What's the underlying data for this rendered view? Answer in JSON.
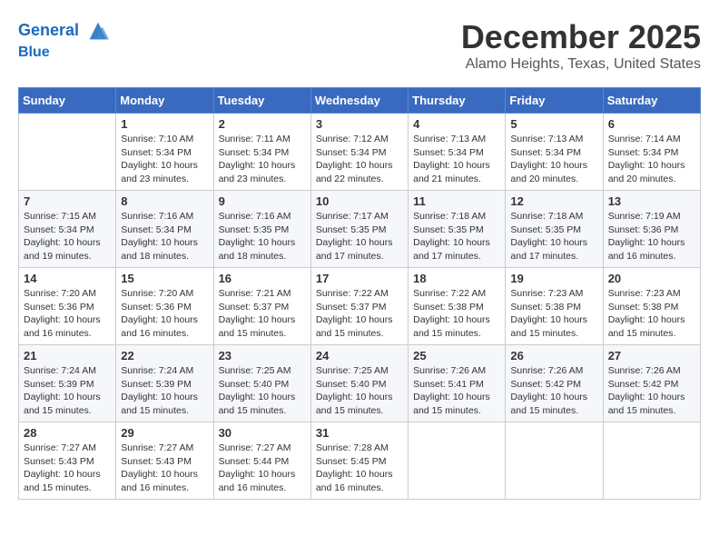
{
  "header": {
    "logo_line1": "General",
    "logo_line2": "Blue",
    "month": "December 2025",
    "location": "Alamo Heights, Texas, United States"
  },
  "days_of_week": [
    "Sunday",
    "Monday",
    "Tuesday",
    "Wednesday",
    "Thursday",
    "Friday",
    "Saturday"
  ],
  "weeks": [
    [
      {
        "day": "",
        "sunrise": "",
        "sunset": "",
        "daylight": ""
      },
      {
        "day": "1",
        "sunrise": "7:10 AM",
        "sunset": "5:34 PM",
        "daylight": "10 hours and 23 minutes."
      },
      {
        "day": "2",
        "sunrise": "7:11 AM",
        "sunset": "5:34 PM",
        "daylight": "10 hours and 23 minutes."
      },
      {
        "day": "3",
        "sunrise": "7:12 AM",
        "sunset": "5:34 PM",
        "daylight": "10 hours and 22 minutes."
      },
      {
        "day": "4",
        "sunrise": "7:13 AM",
        "sunset": "5:34 PM",
        "daylight": "10 hours and 21 minutes."
      },
      {
        "day": "5",
        "sunrise": "7:13 AM",
        "sunset": "5:34 PM",
        "daylight": "10 hours and 20 minutes."
      },
      {
        "day": "6",
        "sunrise": "7:14 AM",
        "sunset": "5:34 PM",
        "daylight": "10 hours and 20 minutes."
      }
    ],
    [
      {
        "day": "7",
        "sunrise": "7:15 AM",
        "sunset": "5:34 PM",
        "daylight": "10 hours and 19 minutes."
      },
      {
        "day": "8",
        "sunrise": "7:16 AM",
        "sunset": "5:34 PM",
        "daylight": "10 hours and 18 minutes."
      },
      {
        "day": "9",
        "sunrise": "7:16 AM",
        "sunset": "5:35 PM",
        "daylight": "10 hours and 18 minutes."
      },
      {
        "day": "10",
        "sunrise": "7:17 AM",
        "sunset": "5:35 PM",
        "daylight": "10 hours and 17 minutes."
      },
      {
        "day": "11",
        "sunrise": "7:18 AM",
        "sunset": "5:35 PM",
        "daylight": "10 hours and 17 minutes."
      },
      {
        "day": "12",
        "sunrise": "7:18 AM",
        "sunset": "5:35 PM",
        "daylight": "10 hours and 17 minutes."
      },
      {
        "day": "13",
        "sunrise": "7:19 AM",
        "sunset": "5:36 PM",
        "daylight": "10 hours and 16 minutes."
      }
    ],
    [
      {
        "day": "14",
        "sunrise": "7:20 AM",
        "sunset": "5:36 PM",
        "daylight": "10 hours and 16 minutes."
      },
      {
        "day": "15",
        "sunrise": "7:20 AM",
        "sunset": "5:36 PM",
        "daylight": "10 hours and 16 minutes."
      },
      {
        "day": "16",
        "sunrise": "7:21 AM",
        "sunset": "5:37 PM",
        "daylight": "10 hours and 15 minutes."
      },
      {
        "day": "17",
        "sunrise": "7:22 AM",
        "sunset": "5:37 PM",
        "daylight": "10 hours and 15 minutes."
      },
      {
        "day": "18",
        "sunrise": "7:22 AM",
        "sunset": "5:38 PM",
        "daylight": "10 hours and 15 minutes."
      },
      {
        "day": "19",
        "sunrise": "7:23 AM",
        "sunset": "5:38 PM",
        "daylight": "10 hours and 15 minutes."
      },
      {
        "day": "20",
        "sunrise": "7:23 AM",
        "sunset": "5:38 PM",
        "daylight": "10 hours and 15 minutes."
      }
    ],
    [
      {
        "day": "21",
        "sunrise": "7:24 AM",
        "sunset": "5:39 PM",
        "daylight": "10 hours and 15 minutes."
      },
      {
        "day": "22",
        "sunrise": "7:24 AM",
        "sunset": "5:39 PM",
        "daylight": "10 hours and 15 minutes."
      },
      {
        "day": "23",
        "sunrise": "7:25 AM",
        "sunset": "5:40 PM",
        "daylight": "10 hours and 15 minutes."
      },
      {
        "day": "24",
        "sunrise": "7:25 AM",
        "sunset": "5:40 PM",
        "daylight": "10 hours and 15 minutes."
      },
      {
        "day": "25",
        "sunrise": "7:26 AM",
        "sunset": "5:41 PM",
        "daylight": "10 hours and 15 minutes."
      },
      {
        "day": "26",
        "sunrise": "7:26 AM",
        "sunset": "5:42 PM",
        "daylight": "10 hours and 15 minutes."
      },
      {
        "day": "27",
        "sunrise": "7:26 AM",
        "sunset": "5:42 PM",
        "daylight": "10 hours and 15 minutes."
      }
    ],
    [
      {
        "day": "28",
        "sunrise": "7:27 AM",
        "sunset": "5:43 PM",
        "daylight": "10 hours and 15 minutes."
      },
      {
        "day": "29",
        "sunrise": "7:27 AM",
        "sunset": "5:43 PM",
        "daylight": "10 hours and 16 minutes."
      },
      {
        "day": "30",
        "sunrise": "7:27 AM",
        "sunset": "5:44 PM",
        "daylight": "10 hours and 16 minutes."
      },
      {
        "day": "31",
        "sunrise": "7:28 AM",
        "sunset": "5:45 PM",
        "daylight": "10 hours and 16 minutes."
      },
      {
        "day": "",
        "sunrise": "",
        "sunset": "",
        "daylight": ""
      },
      {
        "day": "",
        "sunrise": "",
        "sunset": "",
        "daylight": ""
      },
      {
        "day": "",
        "sunrise": "",
        "sunset": "",
        "daylight": ""
      }
    ]
  ],
  "labels": {
    "sunrise_prefix": "Sunrise: ",
    "sunset_prefix": "Sunset: ",
    "daylight_prefix": "Daylight: "
  }
}
